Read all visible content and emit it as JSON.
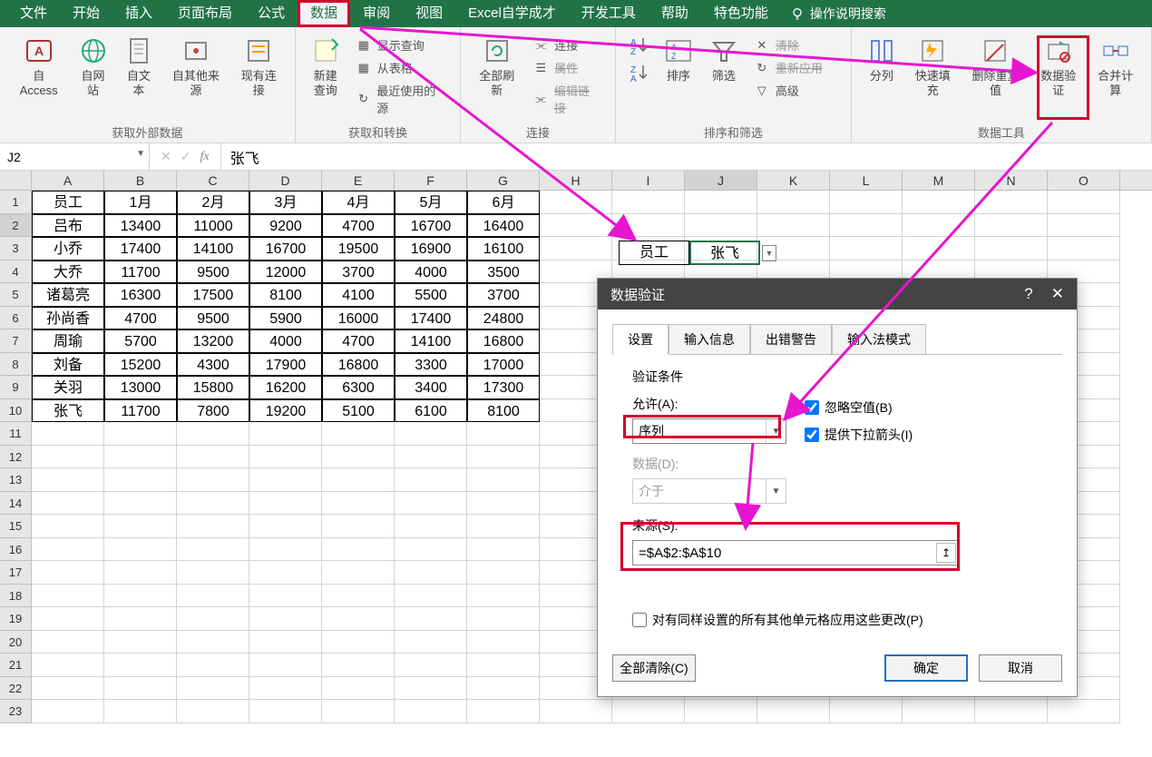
{
  "menubar": {
    "tabs": [
      "文件",
      "开始",
      "插入",
      "页面布局",
      "公式",
      "数据",
      "审阅",
      "视图",
      "Excel自学成才",
      "开发工具",
      "帮助",
      "特色功能"
    ],
    "active_index": 5,
    "search_placeholder": "操作说明搜索"
  },
  "ribbon": {
    "group1": {
      "label": "获取外部数据",
      "buttons": [
        "自 Access",
        "自网站",
        "自文本",
        "自其他来源",
        "现有连接"
      ]
    },
    "group2": {
      "label": "获取和转换",
      "main": "新建\n查询",
      "items": [
        "显示查询",
        "从表格",
        "最近使用的源"
      ]
    },
    "group3": {
      "label": "连接",
      "main": "全部刷新",
      "items": [
        "连接",
        "属性",
        "编辑链接"
      ]
    },
    "group4": {
      "label": "排序和筛选",
      "sort_btn": "排序",
      "filter_btn": "筛选",
      "items": [
        "清除",
        "重新应用",
        "高级"
      ]
    },
    "group5": {
      "label": "数据工具",
      "buttons": [
        "分列",
        "快速填充",
        "删除重复值",
        "数据验证",
        "合并计算"
      ]
    }
  },
  "namebox": {
    "value": "J2"
  },
  "formula_value": "张飞",
  "columns": [
    "A",
    "B",
    "C",
    "D",
    "E",
    "F",
    "G",
    "H",
    "I",
    "J",
    "K",
    "L",
    "M",
    "N",
    "O"
  ],
  "table": {
    "headers": [
      "员工",
      "1月",
      "2月",
      "3月",
      "4月",
      "5月",
      "6月"
    ],
    "rows": [
      [
        "吕布",
        "13400",
        "11000",
        "9200",
        "4700",
        "16700",
        "16400"
      ],
      [
        "小乔",
        "17400",
        "14100",
        "16700",
        "19500",
        "16900",
        "16100"
      ],
      [
        "大乔",
        "11700",
        "9500",
        "12000",
        "3700",
        "4000",
        "3500"
      ],
      [
        "诸葛亮",
        "16300",
        "17500",
        "8100",
        "4100",
        "5500",
        "3700"
      ],
      [
        "孙尚香",
        "4700",
        "9500",
        "5900",
        "16000",
        "17400",
        "24800"
      ],
      [
        "周瑜",
        "5700",
        "13200",
        "4000",
        "4700",
        "14100",
        "16800"
      ],
      [
        "刘备",
        "15200",
        "4300",
        "17900",
        "16800",
        "3300",
        "17000"
      ],
      [
        "关羽",
        "13000",
        "15800",
        "16200",
        "6300",
        "3400",
        "17300"
      ],
      [
        "张飞",
        "11700",
        "7800",
        "19200",
        "5100",
        "6100",
        "8100"
      ]
    ]
  },
  "floating": {
    "label": "员工",
    "value": "张飞"
  },
  "dialog": {
    "title": "数据验证",
    "tabs": [
      "设置",
      "输入信息",
      "出错警告",
      "输入法模式"
    ],
    "active_tab": 0,
    "section": "验证条件",
    "allow_label": "允许(A):",
    "allow_value": "序列",
    "ignore_blank": "忽略空值(B)",
    "dropdown_label": "提供下拉箭头(I)",
    "data_label": "数据(D):",
    "data_value": "介于",
    "source_label": "来源(S):",
    "source_value": "=$A$2:$A$10",
    "apply_all": "对有同样设置的所有其他单元格应用这些更改(P)",
    "clear_all": "全部清除(C)",
    "ok": "确定",
    "cancel": "取消"
  }
}
